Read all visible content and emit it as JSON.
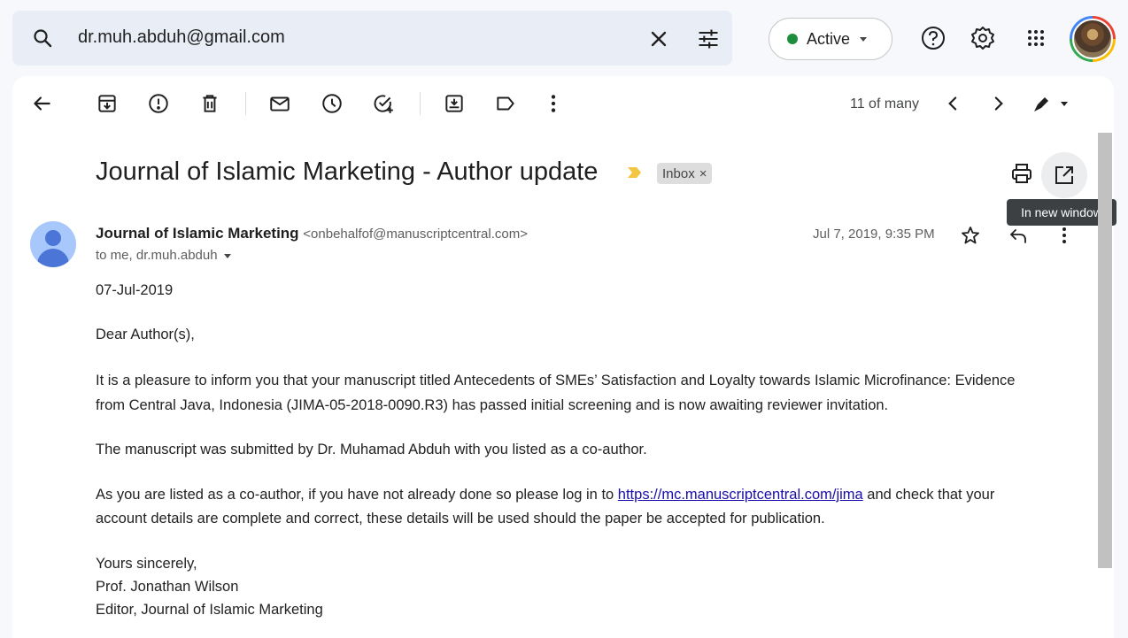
{
  "search": {
    "value": "dr.muh.abduh@gmail.com"
  },
  "status": {
    "label": "Active",
    "color": "#1e8e3e"
  },
  "top_icons": [
    "search-icon",
    "close-icon",
    "tune-icon",
    "help-icon",
    "settings-icon",
    "apps-icon"
  ],
  "toolbar": {
    "icons": [
      "back-arrow-icon",
      "archive-icon",
      "report-spam-icon",
      "delete-icon",
      "mark-unread-icon",
      "snooze-icon",
      "add-to-tasks-icon",
      "move-to-icon",
      "label-icon",
      "more-vert-icon"
    ],
    "pager": "11 of many"
  },
  "message": {
    "subject": "Journal of Islamic Marketing - Author update",
    "label": "Inbox",
    "label_remove": "×",
    "tooltip": "In new window",
    "sender_name": "Journal of Islamic Marketing",
    "sender_email": "<onbehalfof@manuscriptcentral.com>",
    "to": "to me, dr.muh.abduh",
    "date": "Jul 7, 2019, 9:35 PM",
    "body": {
      "date_line": "07-Jul-2019",
      "greeting": "Dear Author(s),",
      "p1_line1": "It is a pleasure to inform you that your manuscript titled Antecedents of SMEs’ Satisfaction and Loyalty towards Islamic Microfinance: Evidence",
      "p1_line2": "from Central Java, Indonesia (JIMA-05-2018-0090.R3) has passed initial screening and is now awaiting reviewer invitation.",
      "p2": "The manuscript was submitted by Dr. Muhamad Abduh with you listed as a co-author.",
      "p3_line1_before": "As you are listed as a co-author, if you have not already done so please log in to ",
      "p3_link": "https://mc.manuscriptcentral.com/jima",
      "p3_line1_after": " and check that your",
      "p3_line2": "account details are complete and correct, these details will be used should the paper be accepted for publication.",
      "closing": "Yours sincerely,",
      "signer": "Prof. Jonathan Wilson",
      "signer_title": "Editor, Journal of Islamic Marketing"
    }
  }
}
